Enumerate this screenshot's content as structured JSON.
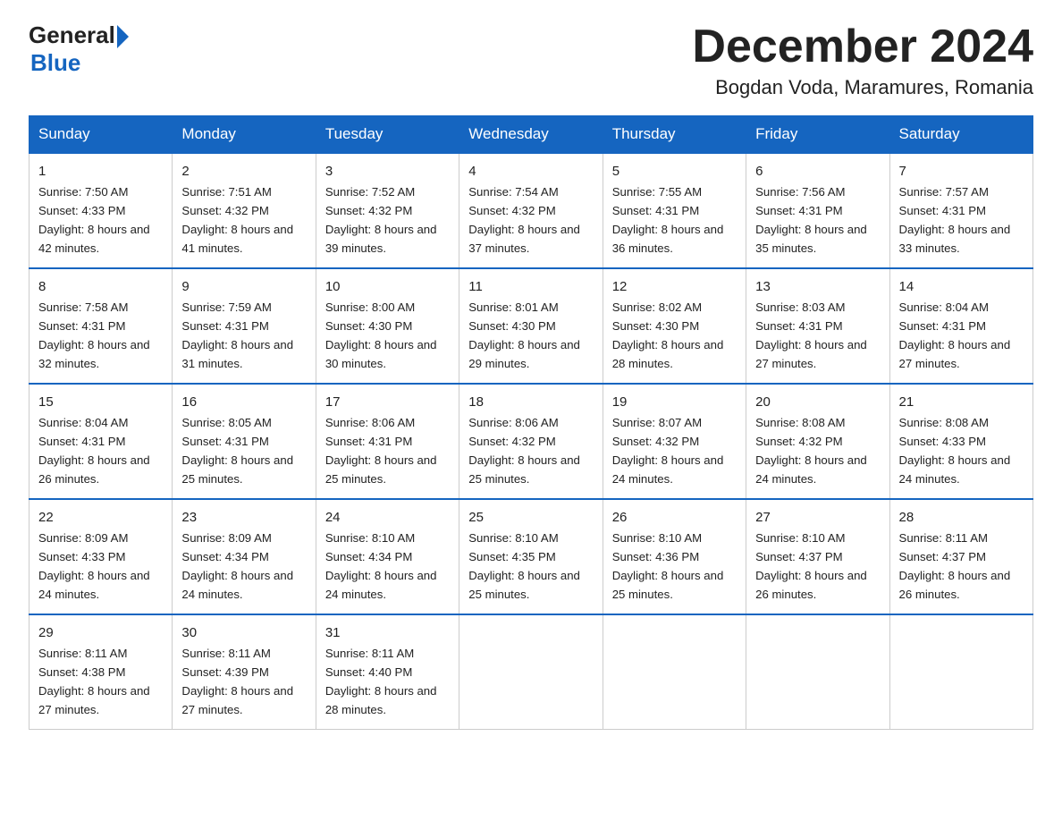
{
  "logo": {
    "general": "General",
    "blue": "Blue",
    "arrow": "▶"
  },
  "title": "December 2024",
  "location": "Bogdan Voda, Maramures, Romania",
  "days_header": [
    "Sunday",
    "Monday",
    "Tuesday",
    "Wednesday",
    "Thursday",
    "Friday",
    "Saturday"
  ],
  "weeks": [
    [
      {
        "day": "1",
        "sunrise": "7:50 AM",
        "sunset": "4:33 PM",
        "daylight": "8 hours and 42 minutes."
      },
      {
        "day": "2",
        "sunrise": "7:51 AM",
        "sunset": "4:32 PM",
        "daylight": "8 hours and 41 minutes."
      },
      {
        "day": "3",
        "sunrise": "7:52 AM",
        "sunset": "4:32 PM",
        "daylight": "8 hours and 39 minutes."
      },
      {
        "day": "4",
        "sunrise": "7:54 AM",
        "sunset": "4:32 PM",
        "daylight": "8 hours and 37 minutes."
      },
      {
        "day": "5",
        "sunrise": "7:55 AM",
        "sunset": "4:31 PM",
        "daylight": "8 hours and 36 minutes."
      },
      {
        "day": "6",
        "sunrise": "7:56 AM",
        "sunset": "4:31 PM",
        "daylight": "8 hours and 35 minutes."
      },
      {
        "day": "7",
        "sunrise": "7:57 AM",
        "sunset": "4:31 PM",
        "daylight": "8 hours and 33 minutes."
      }
    ],
    [
      {
        "day": "8",
        "sunrise": "7:58 AM",
        "sunset": "4:31 PM",
        "daylight": "8 hours and 32 minutes."
      },
      {
        "day": "9",
        "sunrise": "7:59 AM",
        "sunset": "4:31 PM",
        "daylight": "8 hours and 31 minutes."
      },
      {
        "day": "10",
        "sunrise": "8:00 AM",
        "sunset": "4:30 PM",
        "daylight": "8 hours and 30 minutes."
      },
      {
        "day": "11",
        "sunrise": "8:01 AM",
        "sunset": "4:30 PM",
        "daylight": "8 hours and 29 minutes."
      },
      {
        "day": "12",
        "sunrise": "8:02 AM",
        "sunset": "4:30 PM",
        "daylight": "8 hours and 28 minutes."
      },
      {
        "day": "13",
        "sunrise": "8:03 AM",
        "sunset": "4:31 PM",
        "daylight": "8 hours and 27 minutes."
      },
      {
        "day": "14",
        "sunrise": "8:04 AM",
        "sunset": "4:31 PM",
        "daylight": "8 hours and 27 minutes."
      }
    ],
    [
      {
        "day": "15",
        "sunrise": "8:04 AM",
        "sunset": "4:31 PM",
        "daylight": "8 hours and 26 minutes."
      },
      {
        "day": "16",
        "sunrise": "8:05 AM",
        "sunset": "4:31 PM",
        "daylight": "8 hours and 25 minutes."
      },
      {
        "day": "17",
        "sunrise": "8:06 AM",
        "sunset": "4:31 PM",
        "daylight": "8 hours and 25 minutes."
      },
      {
        "day": "18",
        "sunrise": "8:06 AM",
        "sunset": "4:32 PM",
        "daylight": "8 hours and 25 minutes."
      },
      {
        "day": "19",
        "sunrise": "8:07 AM",
        "sunset": "4:32 PM",
        "daylight": "8 hours and 24 minutes."
      },
      {
        "day": "20",
        "sunrise": "8:08 AM",
        "sunset": "4:32 PM",
        "daylight": "8 hours and 24 minutes."
      },
      {
        "day": "21",
        "sunrise": "8:08 AM",
        "sunset": "4:33 PM",
        "daylight": "8 hours and 24 minutes."
      }
    ],
    [
      {
        "day": "22",
        "sunrise": "8:09 AM",
        "sunset": "4:33 PM",
        "daylight": "8 hours and 24 minutes."
      },
      {
        "day": "23",
        "sunrise": "8:09 AM",
        "sunset": "4:34 PM",
        "daylight": "8 hours and 24 minutes."
      },
      {
        "day": "24",
        "sunrise": "8:10 AM",
        "sunset": "4:34 PM",
        "daylight": "8 hours and 24 minutes."
      },
      {
        "day": "25",
        "sunrise": "8:10 AM",
        "sunset": "4:35 PM",
        "daylight": "8 hours and 25 minutes."
      },
      {
        "day": "26",
        "sunrise": "8:10 AM",
        "sunset": "4:36 PM",
        "daylight": "8 hours and 25 minutes."
      },
      {
        "day": "27",
        "sunrise": "8:10 AM",
        "sunset": "4:37 PM",
        "daylight": "8 hours and 26 minutes."
      },
      {
        "day": "28",
        "sunrise": "8:11 AM",
        "sunset": "4:37 PM",
        "daylight": "8 hours and 26 minutes."
      }
    ],
    [
      {
        "day": "29",
        "sunrise": "8:11 AM",
        "sunset": "4:38 PM",
        "daylight": "8 hours and 27 minutes."
      },
      {
        "day": "30",
        "sunrise": "8:11 AM",
        "sunset": "4:39 PM",
        "daylight": "8 hours and 27 minutes."
      },
      {
        "day": "31",
        "sunrise": "8:11 AM",
        "sunset": "4:40 PM",
        "daylight": "8 hours and 28 minutes."
      },
      null,
      null,
      null,
      null
    ]
  ]
}
